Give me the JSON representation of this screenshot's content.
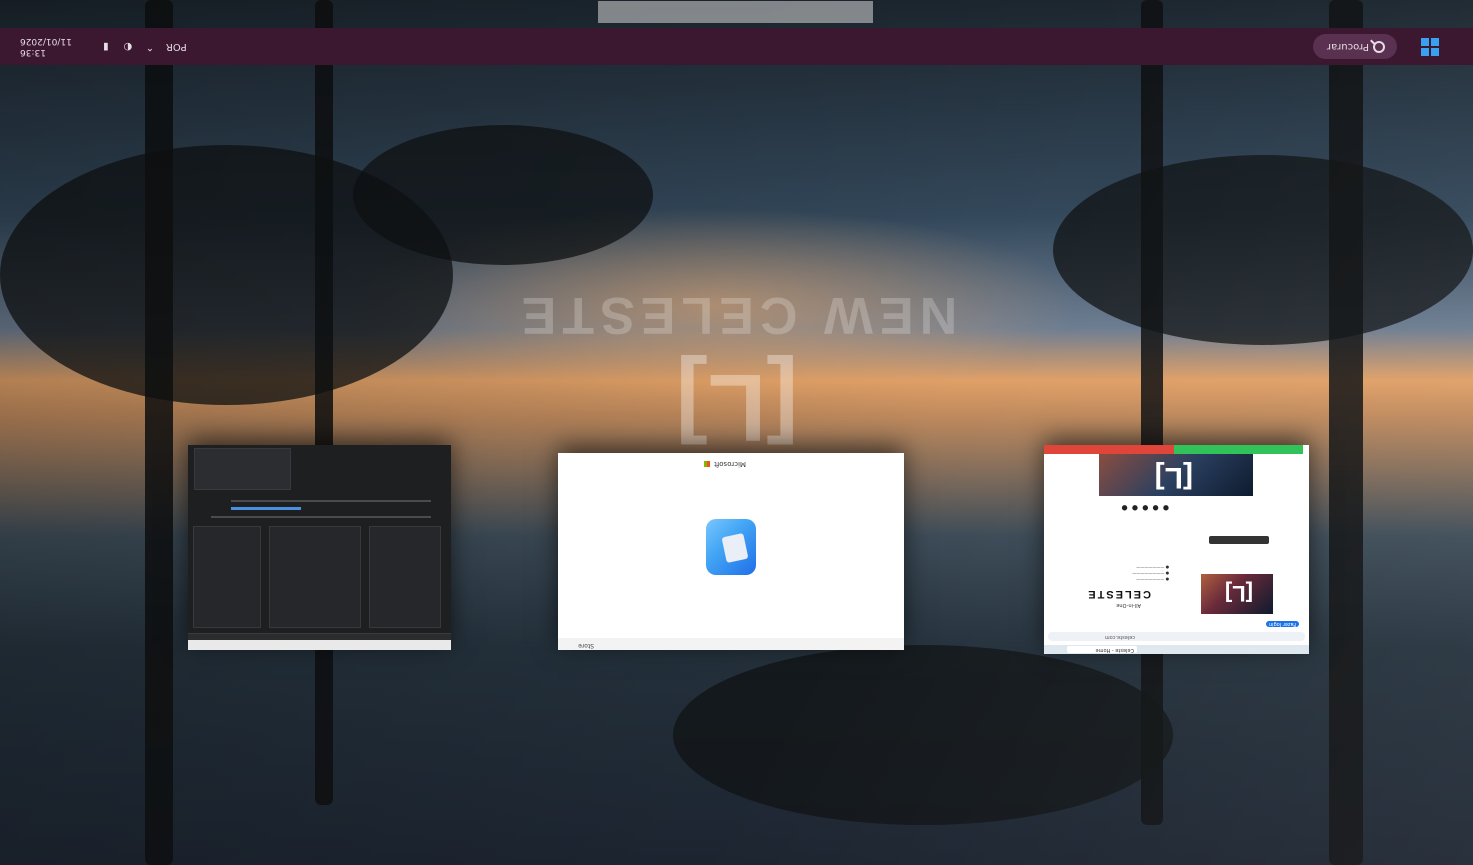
{
  "taskbar": {
    "search_label": "Procurar",
    "language": "POR",
    "time": "13:36",
    "date": "11/01/2026",
    "accent": "#3aa0f0",
    "background": "#3b1830"
  },
  "wallpaper": {
    "logo_text": "[L]",
    "overlay_text": "NEW CELESTE"
  },
  "windows": {
    "store": {
      "title": "Store",
      "publisher": "Microsoft"
    },
    "browser": {
      "heading": "CELESTE",
      "subheading": "All-in-One",
      "login": "Fazer login",
      "address": "celeste.com",
      "tab": "Celeste - Home"
    }
  },
  "icons": [
    "windows-start-icon",
    "search-icon",
    "network-icon",
    "volume-icon",
    "battery-icon",
    "chevron-up-icon"
  ]
}
